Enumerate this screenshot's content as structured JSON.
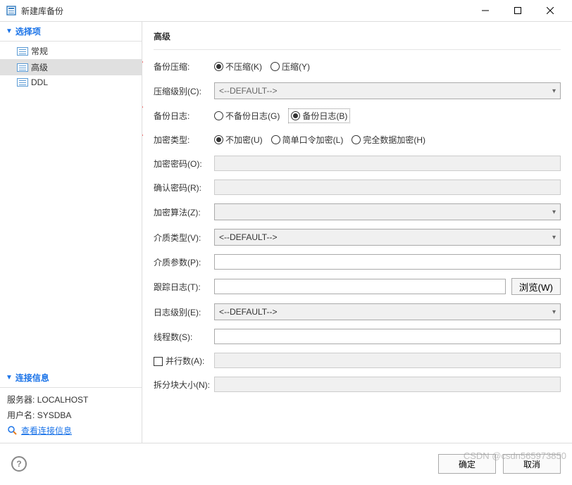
{
  "title": "新建库备份",
  "win": {
    "min": "—",
    "max": "☐",
    "close": "✕"
  },
  "sidebar": {
    "section1_title": "选择项",
    "items": [
      {
        "label": "常规"
      },
      {
        "label": "高级"
      },
      {
        "label": "DDL"
      }
    ],
    "section2_title": "连接信息",
    "server_label": "服务器:",
    "server_value": "LOCALHOST",
    "user_label": "用户名:",
    "user_value": "SYSDBA",
    "view_conn": "查看连接信息"
  },
  "main_title": "高级",
  "form": {
    "compress": {
      "label": "备份压缩:",
      "opt1": "不压缩(K)",
      "opt2": "压缩(Y)"
    },
    "compress_level": {
      "label": "压缩级别(C):",
      "value": "<--DEFAULT-->"
    },
    "backup_log": {
      "label": "备份日志:",
      "opt1": "不备份日志(G)",
      "opt2": "备份日志(B)"
    },
    "encrypt_type": {
      "label": "加密类型:",
      "opt1": "不加密(U)",
      "opt2": "简单口令加密(L)",
      "opt3": "完全数据加密(H)"
    },
    "encrypt_pwd": {
      "label": "加密密码(O):"
    },
    "confirm_pwd": {
      "label": "确认密码(R):"
    },
    "encrypt_algo": {
      "label": "加密算法(Z):"
    },
    "media_type": {
      "label": "介质类型(V):",
      "value": "<--DEFAULT-->"
    },
    "media_params": {
      "label": "介质参数(P):"
    },
    "trace_log": {
      "label": "跟踪日志(T):",
      "browse": "浏览(W)"
    },
    "log_level": {
      "label": "日志级别(E):",
      "value": "<--DEFAULT-->"
    },
    "threads": {
      "label": "线程数(S):"
    },
    "parallel": {
      "label": "并行数(A):"
    },
    "split_size": {
      "label": "拆分块大小(N):"
    }
  },
  "footer": {
    "ok": "确定",
    "cancel": "取消"
  },
  "watermark": "CSDN @csdn565973850"
}
